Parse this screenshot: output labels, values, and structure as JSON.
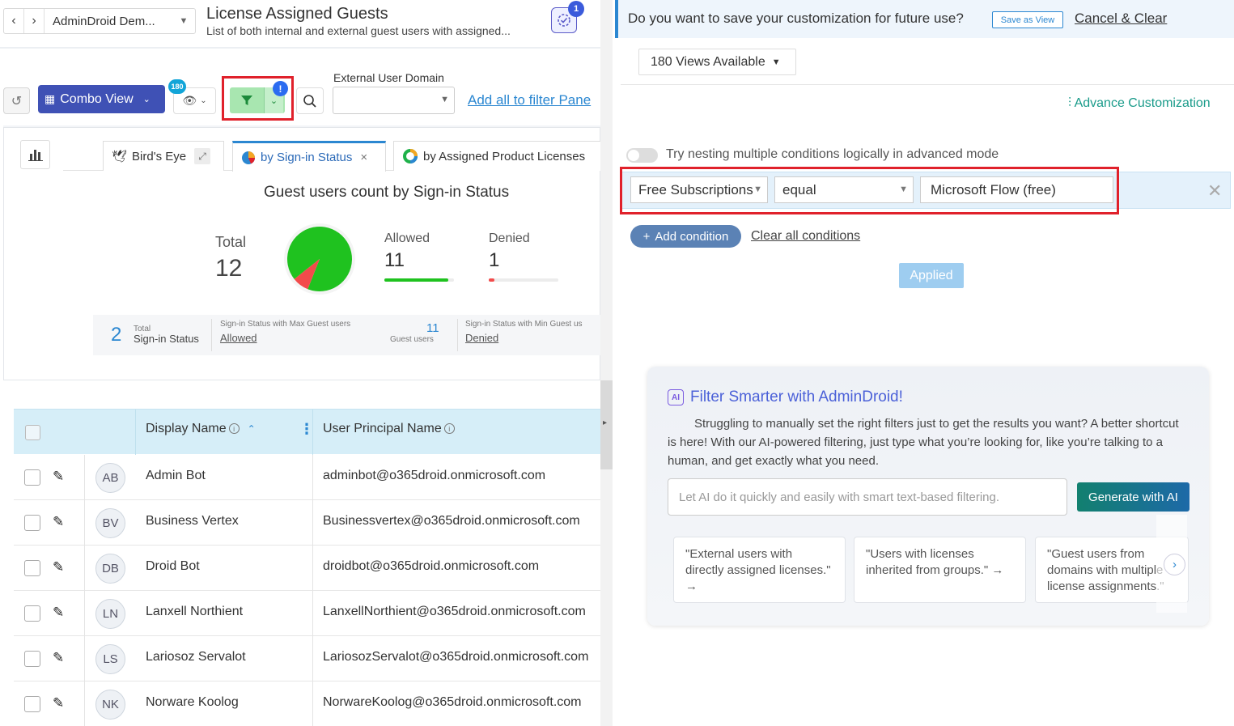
{
  "header": {
    "nav_back": "‹",
    "nav_forward": "›",
    "breadcrumb": "AdminDroid Dem...",
    "title": "License Assigned Guests",
    "subtitle": "List of both internal and external guest users with assigned...",
    "task_badge": "1"
  },
  "toolbar": {
    "combo_view_label": "Combo View",
    "views_badge": "180",
    "filter_alert": "!",
    "external_domain_label": "External User Domain",
    "external_domain_value": "",
    "add_filter_link": "Add all to filter Pane"
  },
  "chart_tabs": [
    {
      "label": "Bird's Eye"
    },
    {
      "label": "by Sign-in Status",
      "close": "×"
    },
    {
      "label": "by Assigned Product Licenses"
    }
  ],
  "chart_data": {
    "type": "pie",
    "title": "Guest users count by Sign-in Status",
    "total_label": "Total",
    "total_value": "12",
    "categories": [
      "Allowed",
      "Denied"
    ],
    "values": [
      11,
      1
    ],
    "colors": [
      "#1fc21f",
      "#f24b4b"
    ]
  },
  "summary": {
    "total_count": "2",
    "total_small": "Total",
    "total_label": "Sign-in Status",
    "max_caption": "Sign-in Status with Max Guest users",
    "max_link": "Allowed",
    "max_count": "11",
    "max_count_caption": "Guest users",
    "min_caption": "Sign-in Status with Min Guest us",
    "min_link": "Denied"
  },
  "grid": {
    "columns": [
      "Display Name",
      "User Principal Name"
    ],
    "rows": [
      {
        "initials": "AB",
        "name": "Admin Bot",
        "upn": "adminbot@o365droid.onmicrosoft.com"
      },
      {
        "initials": "BV",
        "name": "Business Vertex",
        "upn": "Businessvertex@o365droid.onmicrosoft.com"
      },
      {
        "initials": "DB",
        "name": "Droid Bot",
        "upn": "droidbot@o365droid.onmicrosoft.com"
      },
      {
        "initials": "LN",
        "name": "Lanxell Northient",
        "upn": "LanxellNorthient@o365droid.onmicrosoft.com"
      },
      {
        "initials": "LS",
        "name": "Lariosoz Servalot",
        "upn": "LariosozServalot@o365droid.onmicrosoft.com"
      },
      {
        "initials": "NK",
        "name": "Norware Koolog",
        "upn": "NorwareKoolog@o365droid.onmicrosoft.com"
      }
    ]
  },
  "right_panel": {
    "save_question": "Do you want to save your customization for future use?",
    "save_as_view": "Save as View",
    "cancel_clear": "Cancel & Clear",
    "views_available": "180 Views Available",
    "advance_customization": "Advance Customization",
    "nesting_label": "Try nesting multiple conditions logically in advanced mode",
    "condition": {
      "field": "Free Subscriptions",
      "operator": "equal",
      "value": "Microsoft Flow (free)"
    },
    "add_condition": "Add condition",
    "clear_all": "Clear all conditions",
    "applied": "Applied"
  },
  "ai_card": {
    "title": "Filter Smarter with AdminDroid!",
    "icon_text": "AI",
    "description": "Struggling to manually set the right filters just to get the results you want? A better shortcut is here! With our AI-powered filtering, just type what you’re looking for, like you’re talking to a human, and get exactly what you need.",
    "input_placeholder": "Let AI do it quickly and easily with smart text-based filtering.",
    "generate_button": "Generate with AI",
    "suggestions": [
      "\"External users with directly assigned licenses.\" →",
      "\"Users with licenses inherited from groups.\" →",
      "\"Guest users from domains with multiple license assignments.\" →"
    ]
  }
}
